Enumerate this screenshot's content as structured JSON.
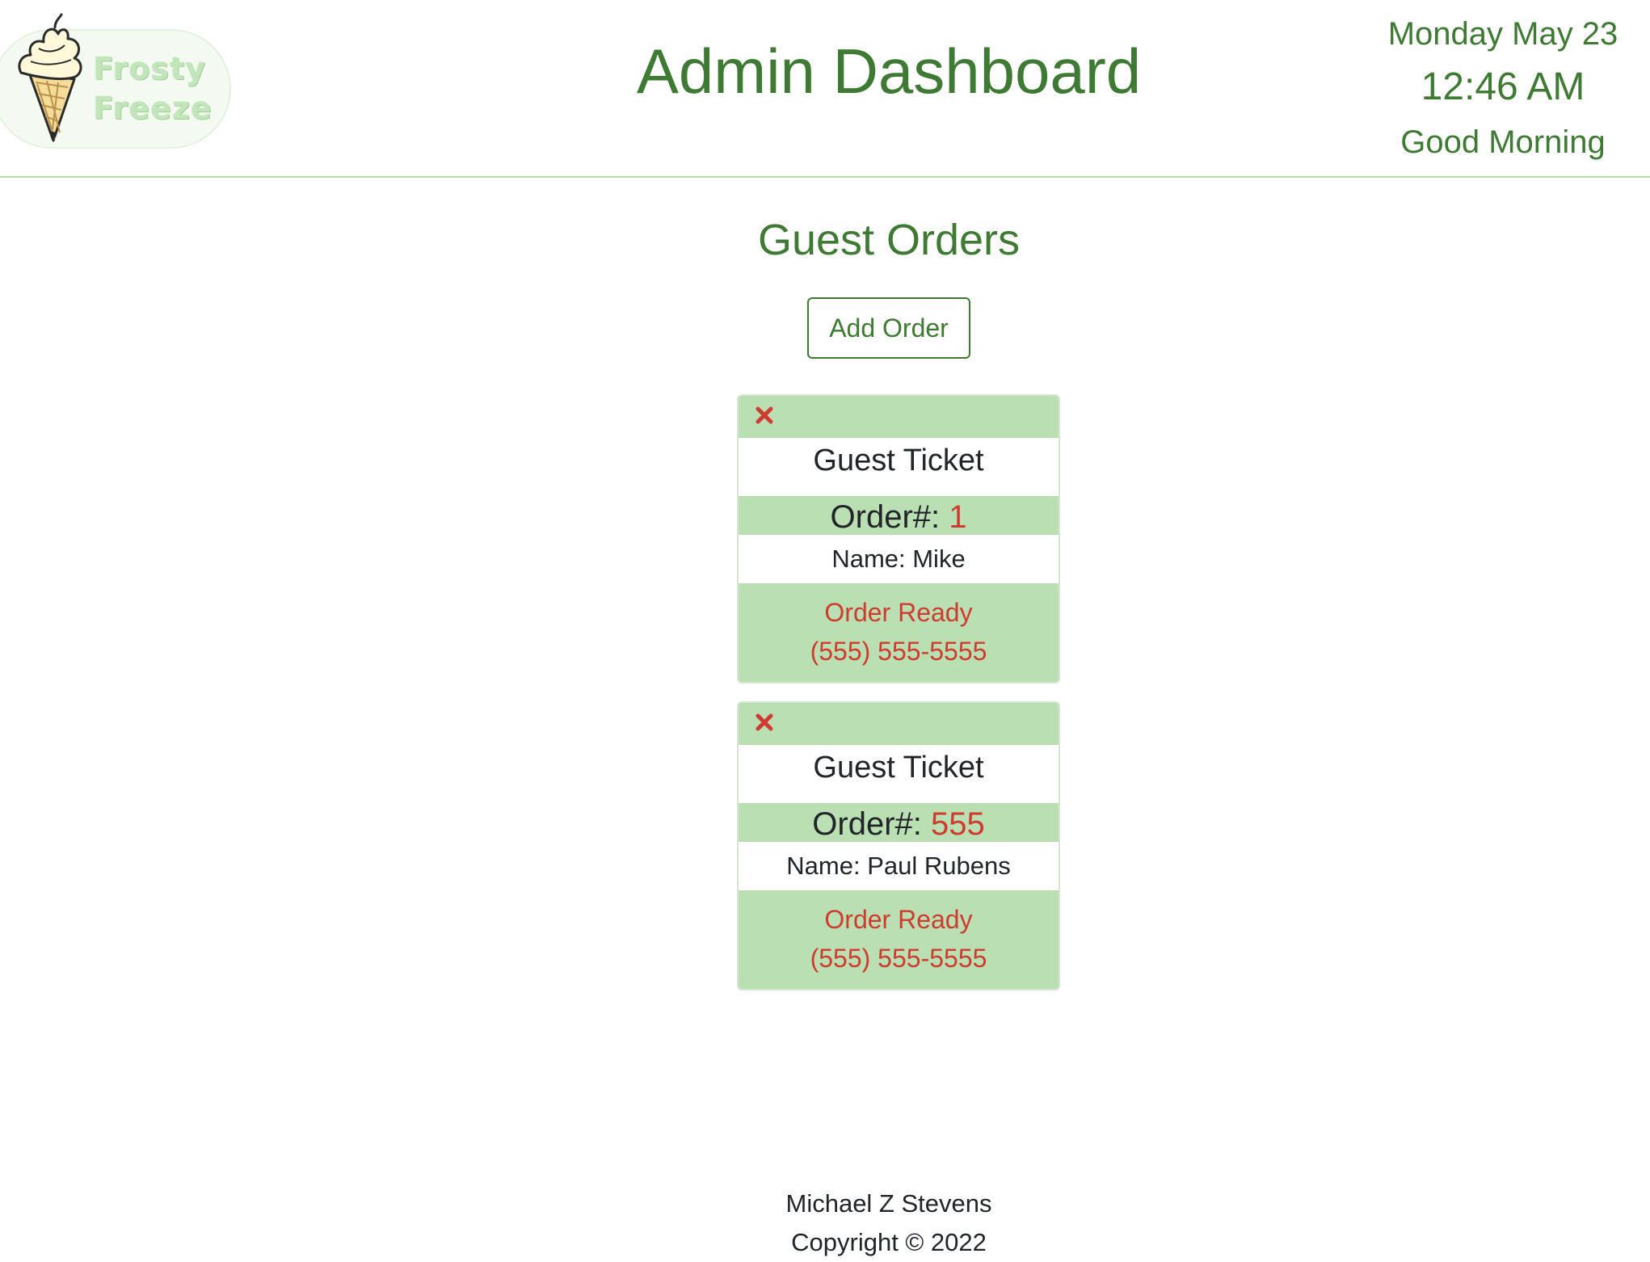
{
  "header": {
    "logo": {
      "line1": "Frosty",
      "line2": "Freeze",
      "icon": "ice-cream-cone-icon"
    },
    "title": "Admin Dashboard",
    "date": "Monday May 23",
    "time": "12:46 AM",
    "greeting": "Good Morning"
  },
  "main": {
    "section_title": "Guest Orders",
    "add_button_label": "Add Order",
    "tickets": [
      {
        "title": "Guest Ticket",
        "order_label": "Order#:",
        "order_number": "1",
        "name_label": "Name:",
        "name": "Mike",
        "status": "Order Ready",
        "phone": "(555) 555-5555"
      },
      {
        "title": "Guest Ticket",
        "order_label": "Order#:",
        "order_number": "555",
        "name_label": "Name:",
        "name": "Paul Rubens",
        "status": "Order Ready",
        "phone": "(555) 555-5555"
      }
    ]
  },
  "footer": {
    "author": "Michael Z Stevens",
    "copyright": "Copyright © 2022"
  },
  "colors": {
    "brand_green": "#3f7a34",
    "ticket_green": "#badfb3",
    "alert_red": "#d03b2f",
    "divider": "#b7dcb0"
  }
}
